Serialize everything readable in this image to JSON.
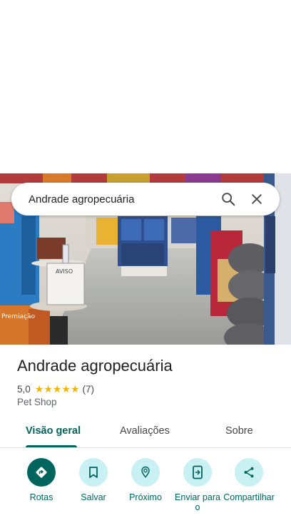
{
  "search": {
    "query": "Andrade agropecuária"
  },
  "photo": {
    "sign_text": "AVISO",
    "box_text": "Premiação"
  },
  "place": {
    "name": "Andrade agropecuária",
    "rating": "5,0",
    "stars": "★★★★★",
    "review_count": "(7)",
    "category": "Pet Shop"
  },
  "tabs": [
    {
      "label": "Visão geral",
      "active": true
    },
    {
      "label": "Avaliações"
    },
    {
      "label": "Sobre"
    }
  ],
  "actions": [
    {
      "label": "Rotas",
      "icon": "directions-icon"
    },
    {
      "label": "Salvar",
      "icon": "bookmark-icon"
    },
    {
      "label": "Próximo",
      "icon": "nearby-icon"
    },
    {
      "label": "Enviar para o",
      "icon": "send-to-phone-icon"
    },
    {
      "label": "Compartilhar",
      "icon": "share-icon"
    }
  ],
  "colors": {
    "accent": "#00665d",
    "chip": "#c9f0f2",
    "star": "#f5b400"
  }
}
